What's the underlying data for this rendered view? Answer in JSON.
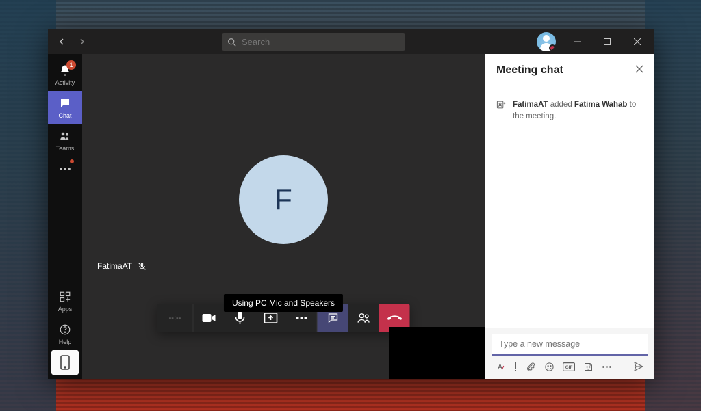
{
  "titlebar": {
    "search_placeholder": "Search"
  },
  "rail": {
    "activity": {
      "label": "Activity",
      "badge": "1"
    },
    "chat": {
      "label": "Chat"
    },
    "teams": {
      "label": "Teams"
    },
    "apps": {
      "label": "Apps"
    },
    "help": {
      "label": "Help"
    }
  },
  "meeting": {
    "participant_initial": "F",
    "participant_name": "FatimaAT",
    "tooltip": "Using PC Mic and Speakers",
    "duration": "--:--"
  },
  "chat": {
    "title": "Meeting chat",
    "message": {
      "actor": "FatimaAT",
      "verb": " added ",
      "subject": "Fatima Wahab",
      "rest": " to the meeting."
    },
    "compose_placeholder": "Type a new message"
  }
}
